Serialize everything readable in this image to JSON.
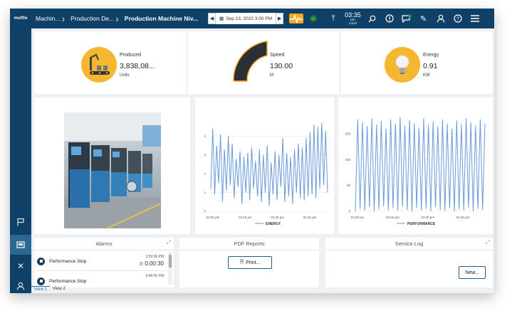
{
  "header": {
    "logo_text": "moffie",
    "breadcrumbs": [
      "Machin...",
      "Production De...",
      "Production Machine Niv..."
    ],
    "date": "Sep 13, 2022 3:00 PM",
    "clock_time": "03:35",
    "clock_ampm": "pm",
    "clock_zone": "Local"
  },
  "kpis": [
    {
      "label": "Produced",
      "value": "3,838,08...",
      "unit": "Units",
      "icon": "conveyor-robot-icon"
    },
    {
      "label": "Speed",
      "value": "130.00",
      "unit": "M",
      "icon": "speed-gauge-icon"
    },
    {
      "label": "Energy",
      "value": "0.91",
      "unit": "KW",
      "icon": "lightbulb-icon"
    }
  ],
  "energy_chart_legend": "ENERGY",
  "performance_chart_legend": "PERFORMANCE",
  "chart_data": [
    {
      "type": "line",
      "legend": "ENERGY",
      "color": "#6a9ad6",
      "ylim": [
        0,
        5
      ],
      "yticks": [
        "0",
        "1",
        "2",
        "3",
        "4"
      ],
      "xticks": [
        "03:00 pm",
        "03:15 pm",
        "03:30 pm",
        "03:45 pm"
      ],
      "x_range_minutes": [
        0,
        60
      ],
      "values": [
        1.2,
        4.4,
        0.9,
        3.5,
        1.5,
        4.1,
        0.5,
        3.3,
        1.1,
        4.0,
        1.4,
        3.6,
        0.7,
        2.8,
        1.3,
        3.2,
        0.4,
        2.9,
        1.0,
        3.1,
        0.6,
        3.4,
        1.2,
        2.7,
        0.8,
        3.3,
        0.5,
        3.0,
        1.0,
        3.5,
        0.3,
        2.6,
        0.9,
        3.2,
        0.6,
        3.0,
        1.3,
        3.9,
        0.5,
        3.1,
        0.8,
        2.9,
        0.4,
        3.3,
        1.0,
        3.6,
        0.7,
        3.4,
        0.6,
        3.9,
        0.8,
        4.2,
        0.9,
        4.6,
        0.7,
        4.5,
        1.2,
        4.7,
        1.4,
        4.3,
        1.0
      ]
    },
    {
      "type": "line",
      "legend": "PERFORMANCE",
      "color": "#6a9ad6",
      "ylim": [
        0,
        190
      ],
      "yticks": [
        "0",
        "50",
        "100",
        "150"
      ],
      "xticks": [
        "03:00 pm",
        "03:15 pm",
        "03:30 pm",
        "03:45 pm"
      ],
      "x_range_minutes": [
        0,
        60
      ],
      "values": [
        0,
        178,
        5,
        172,
        2,
        165,
        8,
        180,
        0,
        168,
        4,
        175,
        10,
        160,
        2,
        178,
        6,
        170,
        1,
        182,
        9,
        166,
        3,
        176,
        0,
        170,
        7,
        162,
        2,
        180,
        5,
        168,
        0,
        174,
        8,
        165,
        3,
        178,
        1,
        170,
        6,
        160,
        0,
        176,
        4,
        168,
        2,
        180,
        7,
        172,
        0,
        165,
        5,
        178,
        3,
        170
      ]
    }
  ],
  "alarms": {
    "title": "Alarms",
    "items": [
      {
        "name": "Performance Stop",
        "time": "3:59:36 PM",
        "duration": "0:00:30"
      },
      {
        "name": "Performance Stop",
        "time": "3:49:36 PM",
        "duration": ""
      }
    ]
  },
  "pdf": {
    "title": "PDF Reports",
    "print_label": "Print..."
  },
  "service": {
    "title": "Service Log",
    "new_label": "New..."
  },
  "views": [
    "View 1",
    "View 2"
  ],
  "colors": {
    "nav": "#0f4067",
    "accent": "#f5b630",
    "line": "#6a9ad6",
    "button_border": "#1f5c8b"
  }
}
